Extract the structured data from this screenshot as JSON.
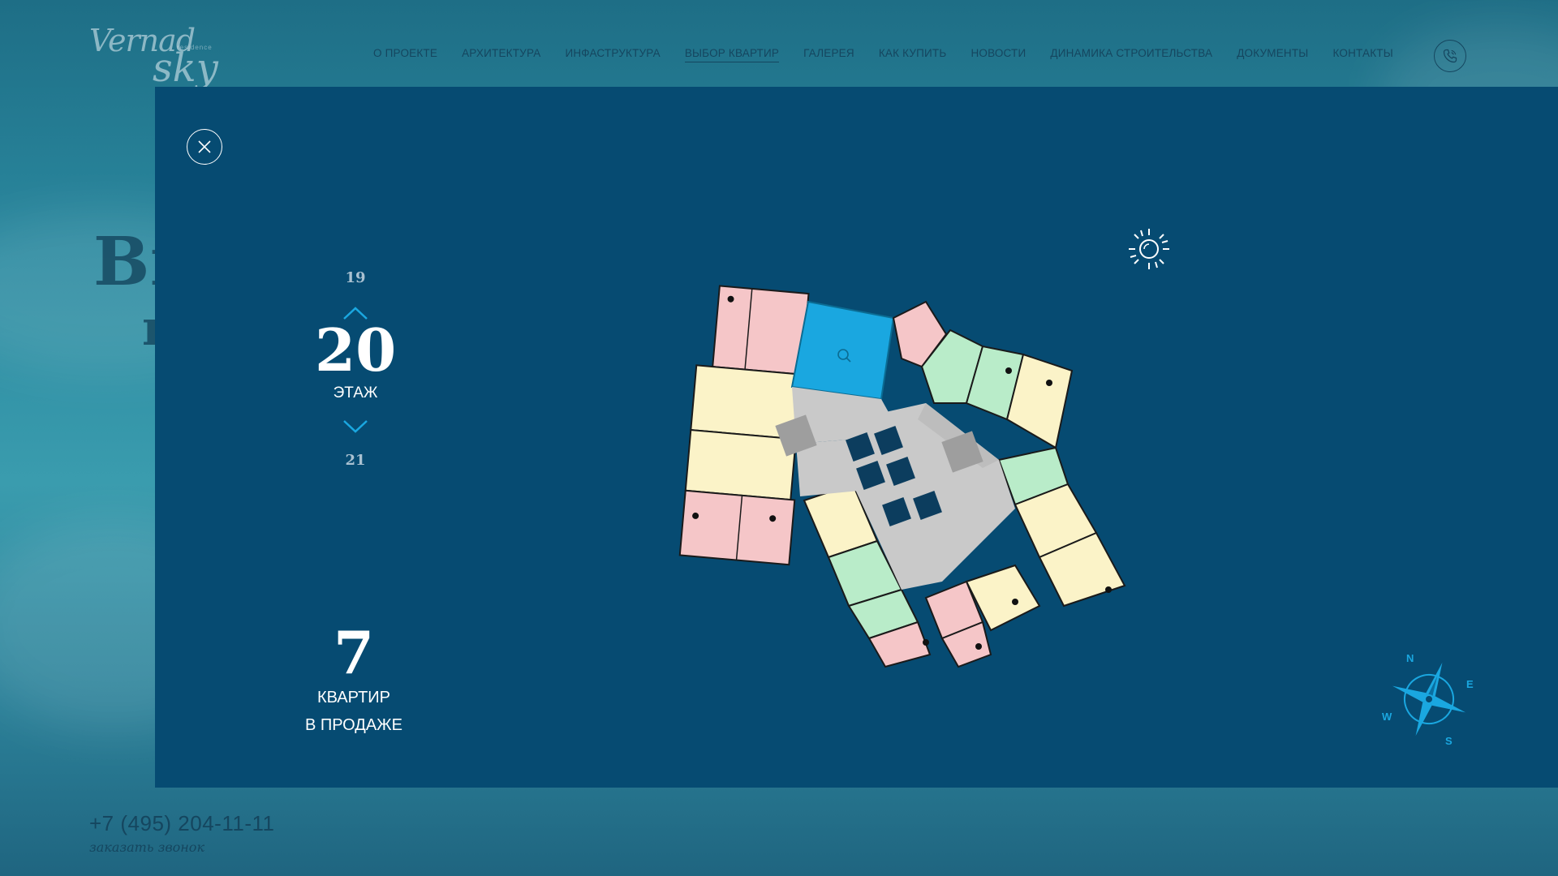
{
  "logo": {
    "line1": "Vernad",
    "line2": "sky",
    "tag": "residence"
  },
  "nav": [
    {
      "label": "О ПРОЕКТЕ"
    },
    {
      "label": "АРХИТЕКТУРА"
    },
    {
      "label": "ИНФАСТРУКТУРА"
    },
    {
      "label": "ВЫБОР КВАРТИР",
      "active": true
    },
    {
      "label": "ГАЛЕРЕЯ"
    },
    {
      "label": "КАК КУПИТЬ"
    },
    {
      "label": "НОВОСТИ"
    },
    {
      "label": "ДИНАМИКА СТРОИТЕЛЬСТВА"
    },
    {
      "label": "ДОКУМЕНТЫ"
    },
    {
      "label": "КОНТАКТЫ"
    }
  ],
  "background": {
    "title_fragment_1": "Вы",
    "title_fragment_2": "п"
  },
  "floor": {
    "prev": "19",
    "current": "20",
    "label": "ЭТАЖ",
    "next": "21"
  },
  "sale": {
    "count": "7",
    "line1": "КВАРТИР",
    "line2": "В ПРОДАЖЕ"
  },
  "compass": {
    "n": "N",
    "e": "E",
    "s": "S",
    "w": "W"
  },
  "footer": {
    "phone": "+7 (495) 204-11-11",
    "callback": "заказать звонок"
  },
  "colors": {
    "modal": "#064b72",
    "accent": "#1aa7e0",
    "pink": "#f5c6c8",
    "green": "#b9ecc9",
    "yellow": "#fbf3c8",
    "selected": "#1aa7e0",
    "corridor": "#c9c9c9"
  },
  "plan": {
    "selected_icon": "magnifier-icon"
  }
}
